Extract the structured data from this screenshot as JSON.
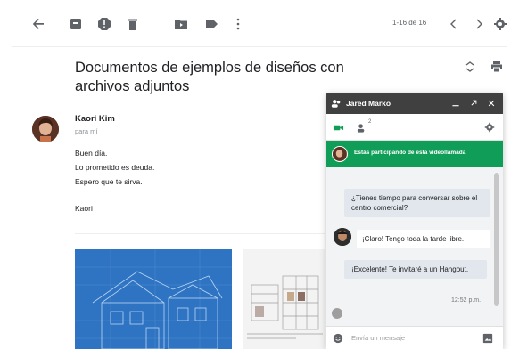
{
  "toolbar": {
    "pager_text": "1-16 de 16",
    "icons": [
      "back-arrow-icon",
      "archive-icon",
      "report-spam-icon",
      "delete-icon",
      "move-to-icon",
      "label-icon",
      "more-vert-icon",
      "chevron-left-icon",
      "chevron-right-icon",
      "settings-gear-icon"
    ]
  },
  "email": {
    "subject": "Documentos de ejemplos de diseños con archivos adjuntos",
    "sender_name": "Kaori Kim",
    "to_label": "para mí",
    "body_lines": [
      "Buen día.",
      "Lo prometido es deuda.",
      "Espero que te sirva."
    ],
    "signature": "Kaori"
  },
  "chat": {
    "title": "Jared Marko",
    "participant_count": "2",
    "banner_text": "Estás participando de esta videollamada",
    "messages": [
      {
        "side": "right",
        "text": "¿Tienes tiempo para conversar sobre el centro comercial?"
      },
      {
        "side": "left",
        "text": "¡Claro! Tengo toda la tarde libre."
      },
      {
        "side": "right",
        "text": "¡Excelente! Te invitaré a un Hangout."
      }
    ],
    "timestamp": "12:52 p.m.",
    "input_placeholder": "Envía un mensaje"
  },
  "colors": {
    "chat_header": "#404040",
    "banner": "#0f9d58",
    "accent_green": "#0f9d58",
    "attachment_blue": "#2f74c3"
  }
}
